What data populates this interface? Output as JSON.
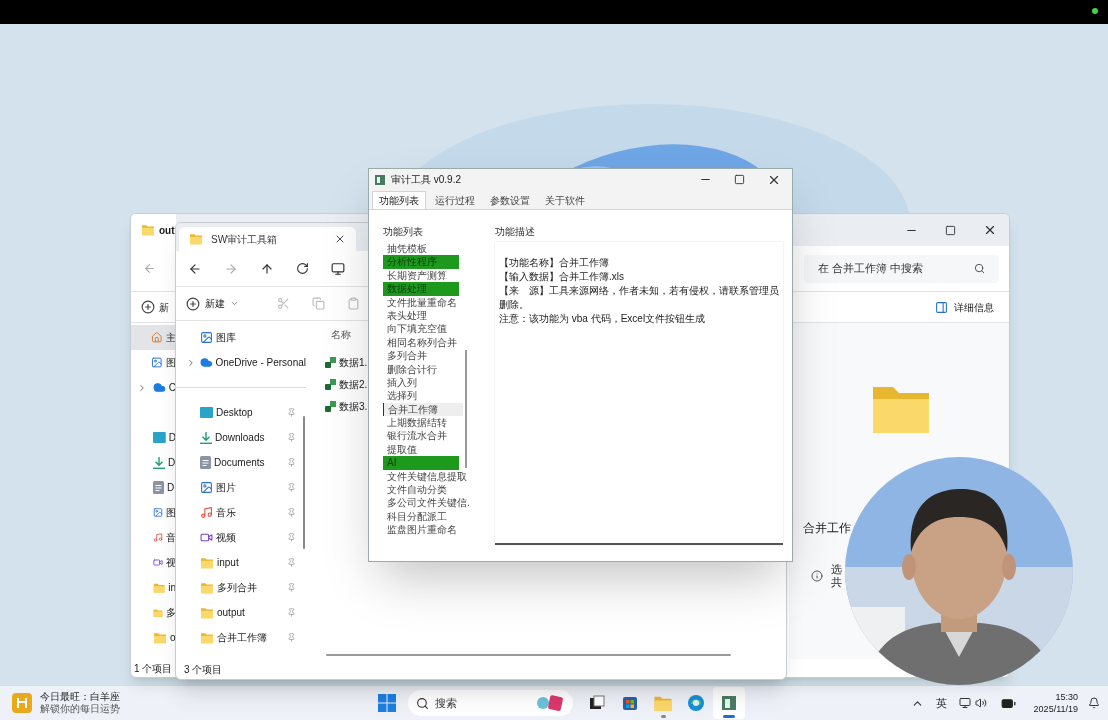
{
  "back_window": {
    "tab": "out",
    "new_button": "新",
    "search_placeholder": "在 合并工作簿 中搜索",
    "details_button": "详细信息",
    "sidebar_top": [
      {
        "label": "主",
        "kind": "home",
        "selected": true,
        "expandable": false
      },
      {
        "label": "图",
        "kind": "gallery",
        "selected": false,
        "expandable": false
      },
      {
        "label": "C",
        "kind": "cloud",
        "selected": false,
        "expandable": true
      }
    ],
    "sidebar_quick": [
      {
        "label": "D",
        "kind": "desktop",
        "selected": false
      },
      {
        "label": "D",
        "kind": "download",
        "selected": false
      },
      {
        "label": "D",
        "kind": "document",
        "selected": false
      },
      {
        "label": "图",
        "kind": "pictures",
        "selected": false
      },
      {
        "label": "音",
        "kind": "music",
        "selected": false
      },
      {
        "label": "视",
        "kind": "video",
        "selected": false
      },
      {
        "label": "in",
        "kind": "folder",
        "selected": false
      },
      {
        "label": "多",
        "kind": "folder",
        "selected": false
      },
      {
        "label": "o",
        "kind": "folder",
        "selected": false
      }
    ],
    "preview_name": "合并工作",
    "info_lines": [
      "选",
      "共"
    ],
    "status": "1 个项目"
  },
  "front_window": {
    "tab": "SW审计工具箱",
    "new_button": "新建",
    "sidebar_top": [
      {
        "label": "图库",
        "kind": "gallery",
        "expandable": false
      },
      {
        "label": "OneDrive - Personal",
        "kind": "cloud",
        "expandable": true
      }
    ],
    "sidebar_quick": [
      {
        "label": "Desktop",
        "kind": "desktop"
      },
      {
        "label": "Downloads",
        "kind": "download"
      },
      {
        "label": "Documents",
        "kind": "document"
      },
      {
        "label": "图片",
        "kind": "pictures"
      },
      {
        "label": "音乐",
        "kind": "music"
      },
      {
        "label": "视频",
        "kind": "video"
      },
      {
        "label": "input",
        "kind": "folder"
      },
      {
        "label": "多列合并",
        "kind": "folder"
      },
      {
        "label": "output",
        "kind": "folder"
      },
      {
        "label": "合并工作簿",
        "kind": "folder"
      }
    ],
    "column": "名称",
    "files": [
      "数据1.",
      "数据2.",
      "数据3."
    ],
    "status": "3 个项目"
  },
  "app_window": {
    "title": "审计工具 v0.9.2",
    "tabs": [
      {
        "label": "功能列表",
        "selected": true
      },
      {
        "label": "运行过程",
        "selected": false
      },
      {
        "label": "参数设置",
        "selected": false
      },
      {
        "label": "关于软件",
        "selected": false
      }
    ],
    "list_title": "功能列表",
    "items": [
      {
        "label": "抽凭模板",
        "kind": "item",
        "selected": false
      },
      {
        "label": "分析性程序",
        "kind": "category",
        "selected": false
      },
      {
        "label": "长期资产测算",
        "kind": "item",
        "selected": false
      },
      {
        "label": "数据处理",
        "kind": "category",
        "selected": false
      },
      {
        "label": "文件批量重命名",
        "kind": "item",
        "selected": false
      },
      {
        "label": "表头处理",
        "kind": "item",
        "selected": false
      },
      {
        "label": "向下填充空值",
        "kind": "item",
        "selected": false
      },
      {
        "label": "相同名称列合并",
        "kind": "item",
        "selected": false
      },
      {
        "label": "多列合并",
        "kind": "item",
        "selected": false
      },
      {
        "label": "删除合计行",
        "kind": "item",
        "selected": false
      },
      {
        "label": "插入列",
        "kind": "item",
        "selected": false
      },
      {
        "label": "选择列",
        "kind": "item",
        "selected": false
      },
      {
        "label": "合并工作簿",
        "kind": "item",
        "selected": true
      },
      {
        "label": "上期数据结转",
        "kind": "item",
        "selected": false
      },
      {
        "label": "银行流水合并",
        "kind": "item",
        "selected": false
      },
      {
        "label": "提取值",
        "kind": "item",
        "selected": false
      },
      {
        "label": "AI",
        "kind": "category",
        "selected": false
      },
      {
        "label": "文件关键信息提取",
        "kind": "item",
        "selected": false
      },
      {
        "label": "文件自动分类",
        "kind": "item",
        "selected": false
      },
      {
        "label": "多公司文件关键信.",
        "kind": "item",
        "selected": false
      },
      {
        "label": "科目分配派工",
        "kind": "item",
        "selected": false
      },
      {
        "label": "监盘图片重命名",
        "kind": "item",
        "selected": false
      }
    ],
    "desc_title": "功能描述",
    "description": [
      "【功能名称】合并工作簿",
      "【输入数据】合并工作簿.xls",
      "【来　源】工具来源网络，作者未知，若有侵权，请联系管理员删除。",
      "注意：该功能为 vba 代码，Excel文件按钮生成"
    ]
  },
  "taskbar": {
    "widget_title": "今日最旺：白羊座",
    "widget_subtitle": "解锁你的每日运势",
    "search_placeholder": "搜索",
    "apps": [
      {
        "kind": "taskview",
        "selected": false,
        "running": false
      },
      {
        "kind": "store",
        "selected": false,
        "running": false
      },
      {
        "kind": "explorer",
        "selected": false,
        "running": true
      },
      {
        "kind": "edge",
        "selected": false,
        "running": false
      },
      {
        "kind": "audit",
        "selected": true,
        "running": true
      }
    ],
    "ime": "英",
    "time": "15:30",
    "date": "2025/11/19"
  }
}
